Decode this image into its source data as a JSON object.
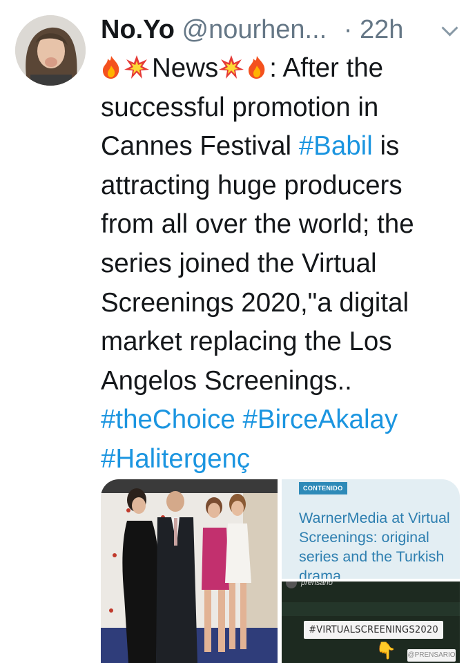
{
  "author": {
    "display_name": "No.Yo",
    "handle": "@nourhen...",
    "separator": "·",
    "time": "22h"
  },
  "tweet": {
    "news_word": "News",
    "lines": [
      ": After the",
      "successful promotion in",
      "Cannes Festival ",
      "attracting huge producers",
      "from all over the world; the",
      "series joined the Virtual",
      "Screenings 2020,\"a digital",
      "market replacing the Los",
      "Angelos Screenings.."
    ],
    "hashtag_babil": "#Babil",
    "after_babil": " is",
    "hashtags_line1": [
      "#theChoice",
      "#BirceAkalay"
    ],
    "hashtag_line2": "#Halitergenç"
  },
  "icons": {
    "fire": "fire-emoji",
    "collision": "collision-emoji",
    "more": "chevron-down-icon"
  },
  "media": {
    "article": {
      "tag": "CONTENIDO",
      "title": "WarnerMedia at Virtual Screenings: original series and the Turkish drama"
    },
    "story": {
      "user": "prensario",
      "hashtag": "#VIRTUALSCREENINGS2020",
      "mention": "@PRENSARIO"
    }
  },
  "colors": {
    "link": "#1b95e0",
    "text": "#14171a",
    "secondary": "#657786"
  }
}
